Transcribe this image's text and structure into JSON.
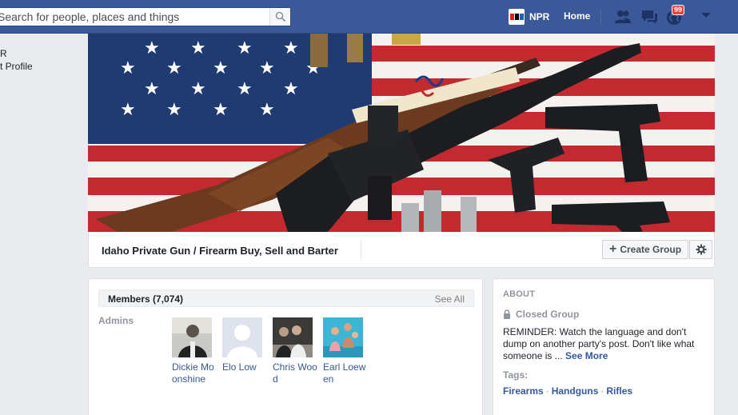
{
  "topbar": {
    "search_placeholder": "Search for people, places and things",
    "npr_label": "NPR",
    "home_label": "Home",
    "notifications_count": "99"
  },
  "left_column": {
    "line1": "R",
    "line2": "t Profile"
  },
  "group": {
    "name": "Idaho Private Gun / Firearm Buy, Sell and Barter",
    "create_group_label": "Create Group"
  },
  "members": {
    "title": "Members (7,074)",
    "see_all": "See All",
    "admins_label": "Admins",
    "admins": [
      {
        "name": "Dickie Moonshine"
      },
      {
        "name": "Elo Low"
      },
      {
        "name": "Chris Wood"
      },
      {
        "name": "Earl Loewen"
      }
    ]
  },
  "about": {
    "title": "ABOUT",
    "privacy": "Closed Group",
    "description": "REMINDER: Watch the language and don't dump on another party's post. Don't like what someone is ...",
    "see_more": "See More",
    "tags_label": "Tags:",
    "tags": [
      "Firearms",
      "Handguns",
      "Rifles"
    ],
    "tag_separator": "·"
  },
  "colors": {
    "topbar": "#3b5998",
    "link": "#365899",
    "badge": "#fa3e3e"
  },
  "icons": [
    "search-icon",
    "friend-requests-icon",
    "messages-icon",
    "notifications-globe-icon",
    "account-caret-icon",
    "gear-icon",
    "lock-icon",
    "plus-icon"
  ]
}
